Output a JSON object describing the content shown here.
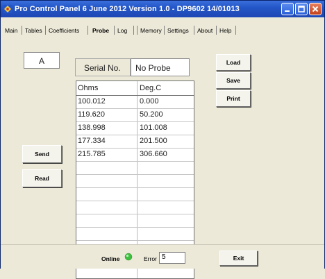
{
  "window": {
    "title": "Pro Control Panel 6 June 2012 Version 1.0 - DP9602 14/01013"
  },
  "menu": {
    "tabs": [
      {
        "label": "Main"
      },
      {
        "label": "Tables"
      },
      {
        "label": "Coefficients"
      },
      {
        "label": "Probe"
      },
      {
        "label": "Log"
      },
      {
        "label": "Memory"
      },
      {
        "label": "Settings"
      },
      {
        "label": "About"
      },
      {
        "label": "Help"
      }
    ]
  },
  "probe": {
    "channel": "A",
    "serial_label": "Serial No.",
    "serial_value": "No Probe",
    "buttons": {
      "load": "Load",
      "save": "Save",
      "print": "Print",
      "send": "Send",
      "read": "Read"
    },
    "table": {
      "headers": [
        "Ohms",
        "Deg.C"
      ],
      "rows": [
        [
          "100.012",
          "0.000"
        ],
        [
          "119.620",
          "50.200"
        ],
        [
          "138.998",
          "101.008"
        ],
        [
          "177.334",
          "201.500"
        ],
        [
          "215.785",
          "306.660"
        ]
      ]
    }
  },
  "status": {
    "online_label": "Online",
    "online_color": "#3fbf3f",
    "error_label": "Error",
    "error_value": "5",
    "exit_label": "Exit"
  }
}
